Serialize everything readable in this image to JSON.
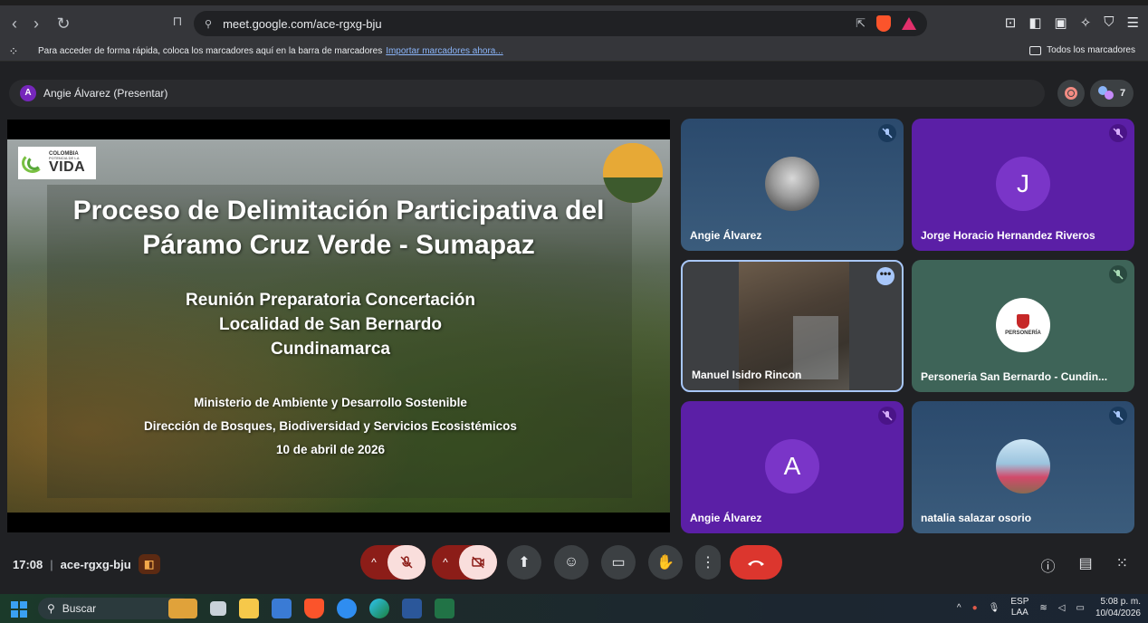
{
  "browser": {
    "url": "meet.google.com/ace-rgxg-bju",
    "bookmarks_hint": "Para acceder de forma rápida, coloca los marcadores aquí en la barra de marcadores",
    "import_link": "Importar marcadores ahora...",
    "all_bookmarks": "Todos los marcadores"
  },
  "meet": {
    "presenter_initial": "A",
    "presenter_label": "Angie Álvarez (Presentar)",
    "participant_count": "7",
    "time": "17:08",
    "meeting_code": "ace-rgxg-bju"
  },
  "slide": {
    "logo_small": "COLOMBIA",
    "logo_tiny": "POTENCIA DE LA",
    "logo_big": "VIDA",
    "title_line1": "Proceso de Delimitación Participativa del",
    "title_line2": "Páramo Cruz Verde - Sumapaz",
    "sub_line1": "Reunión Preparatoria Concertación",
    "sub_line2": "Localidad de San Bernardo",
    "sub_line3": "Cundinamarca",
    "inst_line1": "Ministerio de Ambiente y Desarrollo Sostenible",
    "inst_line2": "Dirección de Bosques, Biodiversidad y Servicios Ecosistémicos",
    "date": "10 de abril de 2026"
  },
  "tiles": [
    {
      "name": "Angie Álvarez"
    },
    {
      "name": "Jorge Horacio Hernandez Riveros",
      "initial": "J"
    },
    {
      "name": "Manuel Isidro Rincon"
    },
    {
      "name": "Personeria San Bernardo - Cundin...",
      "logo_text": "PERSONERÍA"
    },
    {
      "name": "Angie Álvarez",
      "initial": "A"
    },
    {
      "name": "natalia salazar osorio"
    }
  ],
  "taskbar": {
    "search_label": "Buscar",
    "lang_line1": "ESP",
    "lang_line2": "LAA",
    "clock_time": "5:08 p. m.",
    "clock_date": "10/04/2026"
  },
  "colors": {
    "purple_tile": "#5b1fa6",
    "hangup": "#dc362e",
    "mute_pink": "#f9dedc"
  }
}
